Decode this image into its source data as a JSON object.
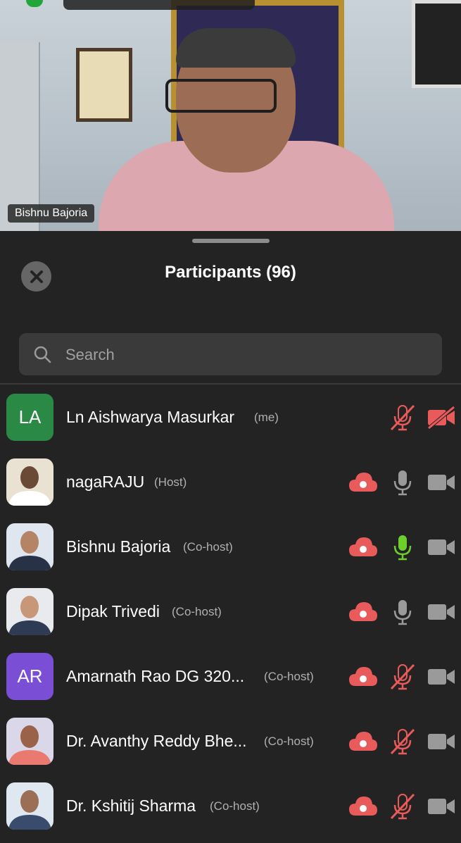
{
  "video": {
    "speaker_name": "Bishnu Bajoria"
  },
  "panel": {
    "title": "Participants (96)",
    "search_placeholder": "Search"
  },
  "colors": {
    "red": "#e95a5a",
    "green": "#6ccf2c",
    "grey": "#9a9a9a",
    "la": "#2a8a45",
    "ar": "#7a4fd6"
  },
  "participants": [
    {
      "name": "Ln Aishwarya Masurkar",
      "role": "(me)",
      "avatar": "LA",
      "mic": "muted",
      "video": "off"
    },
    {
      "name": "nagaRAJU",
      "role": "(Host)",
      "avatar": "photo",
      "cloud": true,
      "mic": "on",
      "video": "on-grey"
    },
    {
      "name": "Bishnu Bajoria",
      "role": "(Co-host)",
      "avatar": "photo",
      "cloud": true,
      "mic": "speaking",
      "video": "on-grey"
    },
    {
      "name": "Dipak Trivedi",
      "role": "(Co-host)",
      "avatar": "photo",
      "cloud": true,
      "mic": "on",
      "video": "on-grey"
    },
    {
      "name": "Amarnath Rao DG 320...",
      "role": "(Co-host)",
      "avatar": "AR",
      "cloud": true,
      "mic": "muted",
      "video": "on-grey"
    },
    {
      "name": "Dr. Avanthy Reddy Bhe...",
      "role": "(Co-host)",
      "avatar": "photo",
      "cloud": true,
      "mic": "muted",
      "video": "on-grey"
    },
    {
      "name": "Dr. Kshitij Sharma",
      "role": "(Co-host)",
      "avatar": "photo",
      "cloud": true,
      "mic": "muted",
      "video": "on-grey"
    }
  ]
}
